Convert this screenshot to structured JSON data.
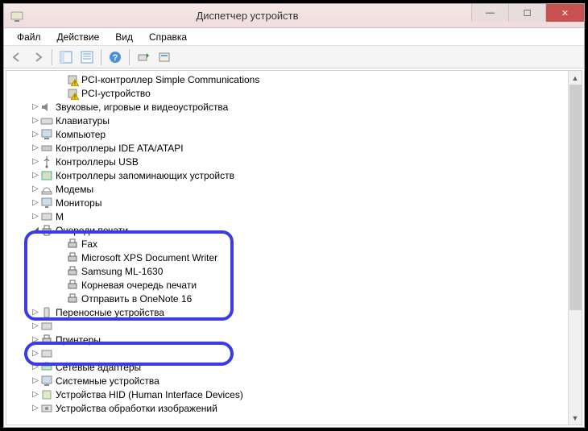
{
  "window": {
    "title": "Диспетчер устройств"
  },
  "menu": {
    "file": "Файл",
    "action": "Действие",
    "view": "Вид",
    "help": "Справка"
  },
  "tree": {
    "pci_simple": "PCI-контроллер Simple Communications",
    "pci_device": "PCI-устройство",
    "sound": "Звуковые, игровые и видеоустройства",
    "keyboards": "Клавиатуры",
    "computer": "Компьютер",
    "ide_ata": "Контроллеры IDE ATA/ATAPI",
    "usb_ctrl": "Контроллеры USB",
    "storage_ctrl": "Контроллеры запоминающих устройств",
    "modems": "Модемы",
    "monitors": "Мониторы",
    "mice_truncated": "М",
    "print_queues": "Очереди печати",
    "pq_fax": "Fax",
    "pq_xps": "Microsoft XPS Document Writer",
    "pq_samsung": "Samsung ML-1630",
    "pq_root": "Корневая очередь печати",
    "pq_onenote": "Отправить в OneNote 16",
    "portable": "Переносные устройства",
    "hidden_row": "",
    "printers": "Принтеры",
    "hidden_row2": "",
    "net_adapters": "Сетевые адаптеры",
    "sys_devices": "Системные устройства",
    "hid": "Устройства HID (Human Interface Devices)",
    "imaging": "Устройства обработки изображений"
  }
}
